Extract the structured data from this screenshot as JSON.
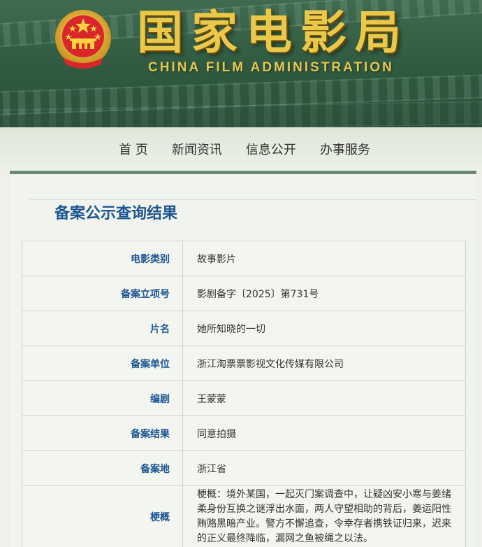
{
  "header": {
    "title_cn": "国家电影局",
    "title_en": "CHINA FILM ADMINISTRATION",
    "brand_gold": "#e9c84a",
    "brand_green": "#2f5a40"
  },
  "nav": {
    "items": [
      "首 页",
      "新闻资讯",
      "信息公开",
      "办事服务"
    ]
  },
  "page": {
    "title": "备案公示查询结果"
  },
  "record": {
    "rows": [
      {
        "label": "电影类别",
        "value": "故事影片"
      },
      {
        "label": "备案立项号",
        "value": "影剧备字〔2025〕第731号"
      },
      {
        "label": "片名",
        "value": "她所知晓的一切"
      },
      {
        "label": "备案单位",
        "value": "浙江淘票票影视文化传媒有限公司"
      },
      {
        "label": "编剧",
        "value": "王蒙蒙"
      },
      {
        "label": "备案结果",
        "value": "同意拍摄"
      },
      {
        "label": "备案地",
        "value": "浙江省"
      }
    ],
    "synopsis": {
      "label": "梗概",
      "value": "梗概：境外某国，一起灭门案调查中，让疑凶安小寒与姜绪柔身份互换之谜浮出水面，两人守望相助的背后，姜运阳性贿赂黑暗产业。警方不懈追查，令幸存者携铁证归来，迟来的正义最终降临，漏网之鱼被绳之以法。"
    }
  },
  "colors": {
    "label_blue": "#1d5690",
    "nav_bar": "#6c8a73"
  }
}
